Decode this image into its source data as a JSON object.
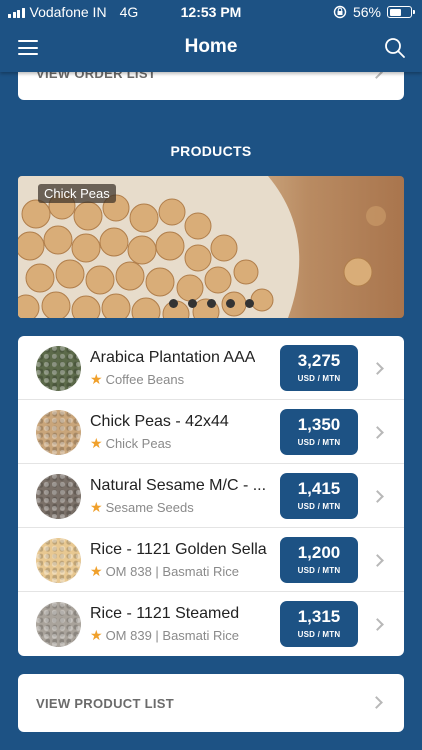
{
  "status_bar": {
    "carrier": "Vodafone IN",
    "network": "4G",
    "time": "12:53 PM",
    "battery": "56%",
    "battery_level": 0.56
  },
  "nav": {
    "title": "Home"
  },
  "order_card": {
    "label": "VIEW ORDER LIST"
  },
  "products": {
    "heading": "PRODUCTS",
    "carousel": {
      "label": "Chick Peas",
      "dot_count": 5
    },
    "items": [
      {
        "name": "Arabica Plantation AAA",
        "category": "Coffee Beans",
        "price": "3,275",
        "unit": "USD / MTN",
        "thumb_color": "#5c6a4a"
      },
      {
        "name": "Chick Peas - 42x44",
        "category": "Chick Peas",
        "price": "1,350",
        "unit": "USD / MTN",
        "thumb_color": "#c9a57a"
      },
      {
        "name": "Natural Sesame M/C - ...",
        "category": "Sesame Seeds",
        "price": "1,415",
        "unit": "USD / MTN",
        "thumb_color": "#7a7068"
      },
      {
        "name": "Rice - 1121 Golden Sella",
        "category": "OM 838 | Basmati Rice",
        "price": "1,200",
        "unit": "USD / MTN",
        "thumb_color": "#e8c891"
      },
      {
        "name": "Rice - 1121 Steamed",
        "category": "OM 839 | Basmati Rice",
        "price": "1,315",
        "unit": "USD / MTN",
        "thumb_color": "#a9a39b"
      }
    ]
  },
  "product_list_card": {
    "label": "VIEW PRODUCT LIST"
  },
  "colors": {
    "brand_blue": "#1d5284",
    "star": "#f0a02b"
  }
}
